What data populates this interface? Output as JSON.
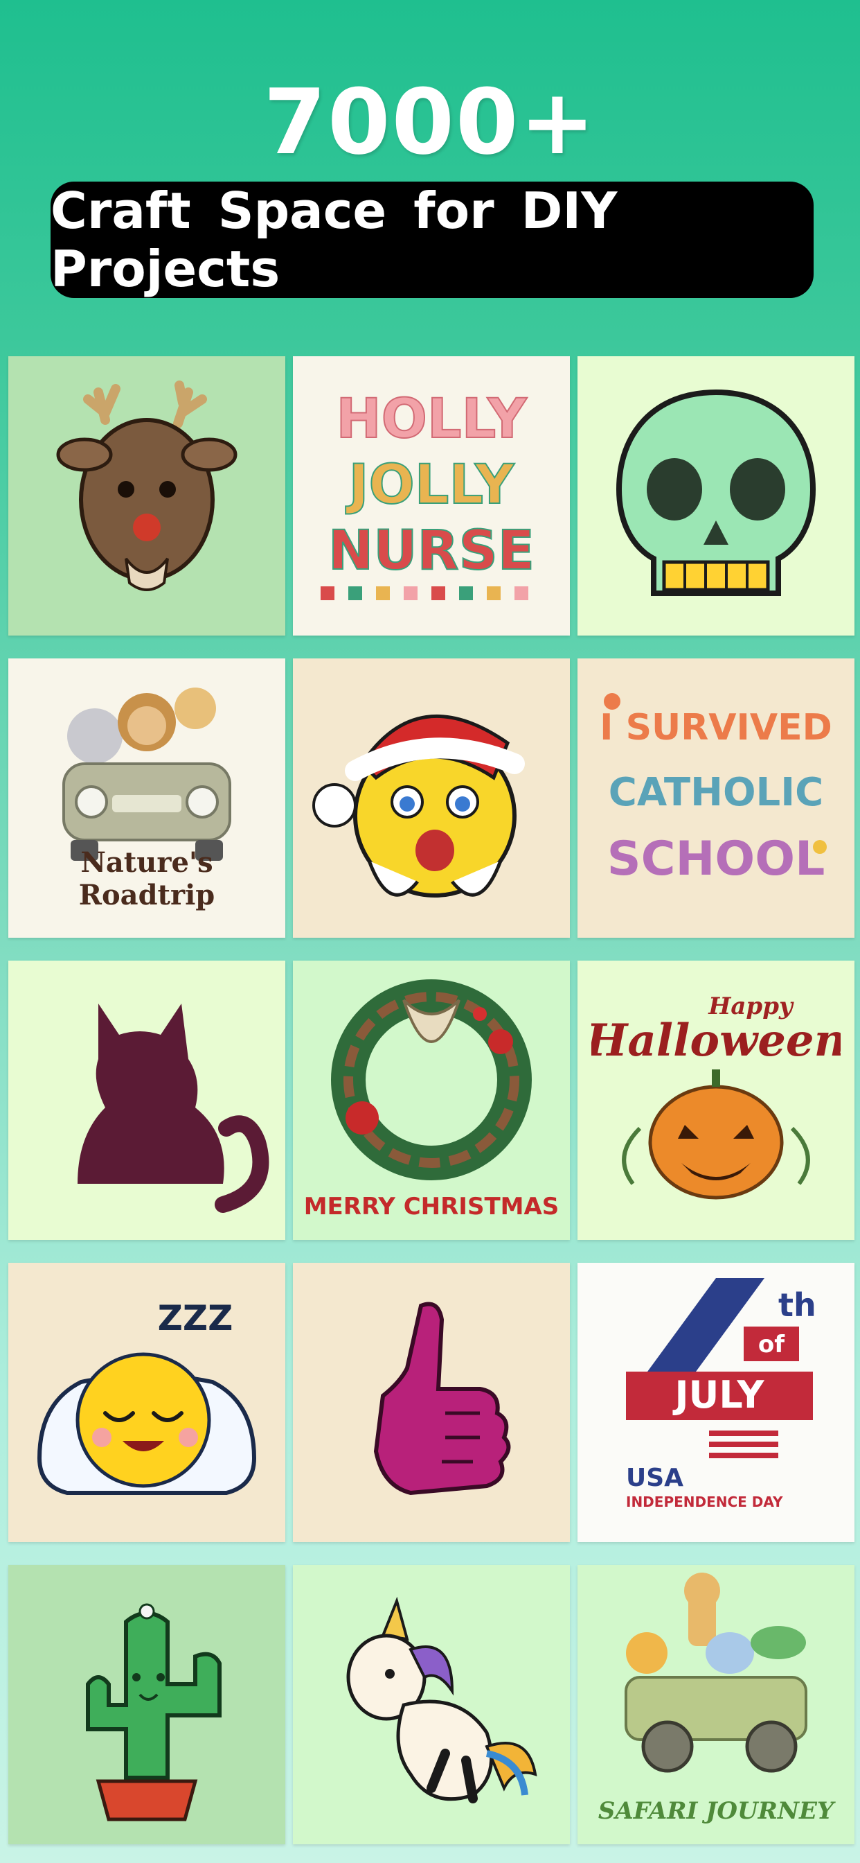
{
  "hero": {
    "count": "7000+",
    "tagline": "Craft Space for DIY Projects"
  },
  "tiles": [
    {
      "name": "reindeer-sticker",
      "label": ""
    },
    {
      "name": "holly-jolly-nurse-design",
      "label": ""
    },
    {
      "name": "skull-sticker",
      "label": ""
    },
    {
      "name": "natures-roadtrip-design",
      "label": "Nature's Roadtrip"
    },
    {
      "name": "santa-emoji-sticker",
      "label": ""
    },
    {
      "name": "i-survived-catholic-school-design",
      "label": ""
    },
    {
      "name": "cat-silhouette",
      "label": ""
    },
    {
      "name": "christmas-wreath-design",
      "label": "MERRY CHRISTMAS"
    },
    {
      "name": "happy-halloween-design",
      "label": ""
    },
    {
      "name": "sleepy-emoji-sticker",
      "label": ""
    },
    {
      "name": "thumbs-up-icon",
      "label": ""
    },
    {
      "name": "fourth-of-july-design",
      "label": "USA"
    },
    {
      "name": "cactus-sticker",
      "label": ""
    },
    {
      "name": "unicorn-sticker",
      "label": ""
    },
    {
      "name": "safari-journey-design",
      "label": "SAFARI JOURNEY"
    }
  ],
  "artwork_text": {
    "holly": "HOLLY",
    "jolly": "JOLLY",
    "nurse": "NURSE",
    "i_survived": "I SURVIVED",
    "catholic": "CATHOLIC",
    "school": "SCHOOL",
    "happy": "Happy",
    "halloween": "Halloween",
    "fourth": "4",
    "th": "th",
    "of": "of",
    "july": "JULY",
    "independence": "INDEPENDENCE DAY",
    "zzz": "ZZZ"
  }
}
